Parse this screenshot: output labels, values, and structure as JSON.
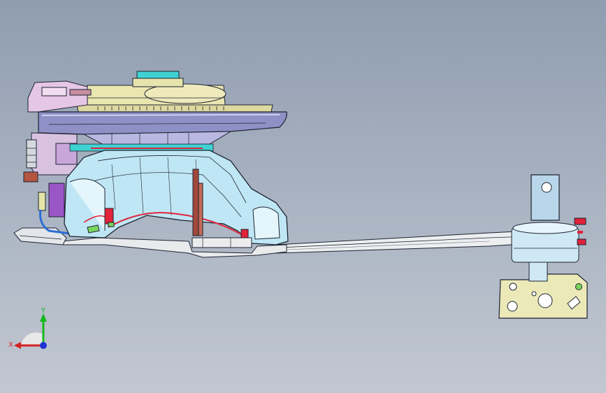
{
  "view": {
    "background_top": "#8f9db0",
    "background_bottom": "#c2c8d2"
  },
  "colors": {
    "outline": "#1d2330",
    "shell_blue": "#bfe6f4",
    "shell_light": "#e4f6fb",
    "khaki": "#e9e6b0",
    "lavender": "#8e90c6",
    "lavender_light": "#b9b8e2",
    "pink": "#e5c6e6",
    "violet": "#9a55c7",
    "red": "#e0233a",
    "brown": "#a2483c",
    "cyan": "#3fd2d3",
    "sheet": "#eceef0",
    "green_dot": "#7ad65b"
  },
  "triad": {
    "y_label": "Y",
    "x_label": "X",
    "y_color": "#16b81e",
    "x_color": "#d42222",
    "z_color": "#1c34d6",
    "hub_color": "#e8e8e8"
  }
}
